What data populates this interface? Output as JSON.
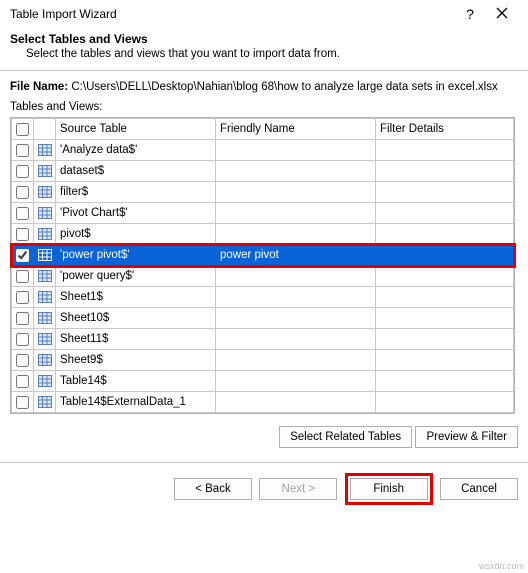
{
  "window": {
    "title": "Table Import Wizard",
    "help": "?",
    "heading": "Select Tables and Views",
    "subheading": "Select the tables and views that you want to import data from."
  },
  "file": {
    "label": "File Name:",
    "path": "C:\\Users\\DELL\\Desktop\\Nahian\\blog 68\\how to analyze large data sets in excel.xlsx"
  },
  "grid": {
    "caption": "Tables and Views:",
    "headers": {
      "source": "Source Table",
      "friendly": "Friendly Name",
      "filter": "Filter Details"
    },
    "rows": [
      {
        "checked": false,
        "source": "'Analyze data$'",
        "friendly": "",
        "filter": "",
        "selected": false
      },
      {
        "checked": false,
        "source": "dataset$",
        "friendly": "",
        "filter": "",
        "selected": false
      },
      {
        "checked": false,
        "source": "filter$",
        "friendly": "",
        "filter": "",
        "selected": false
      },
      {
        "checked": false,
        "source": "'Pivot Chart$'",
        "friendly": "",
        "filter": "",
        "selected": false
      },
      {
        "checked": false,
        "source": "pivot$",
        "friendly": "",
        "filter": "",
        "selected": false
      },
      {
        "checked": true,
        "source": "'power pivot$'",
        "friendly": "power pivot",
        "filter": "",
        "selected": true
      },
      {
        "checked": false,
        "source": "'power query$'",
        "friendly": "",
        "filter": "",
        "selected": false
      },
      {
        "checked": false,
        "source": "Sheet1$",
        "friendly": "",
        "filter": "",
        "selected": false
      },
      {
        "checked": false,
        "source": "Sheet10$",
        "friendly": "",
        "filter": "",
        "selected": false
      },
      {
        "checked": false,
        "source": "Sheet11$",
        "friendly": "",
        "filter": "",
        "selected": false
      },
      {
        "checked": false,
        "source": "Sheet9$",
        "friendly": "",
        "filter": "",
        "selected": false
      },
      {
        "checked": false,
        "source": "Table14$",
        "friendly": "",
        "filter": "",
        "selected": false
      },
      {
        "checked": false,
        "source": "Table14$ExternalData_1",
        "friendly": "",
        "filter": "",
        "selected": false
      }
    ]
  },
  "buttons": {
    "selectRelated": "Select Related Tables",
    "previewFilter": "Preview & Filter",
    "back": "< Back",
    "next": "Next >",
    "finish": "Finish",
    "cancel": "Cancel"
  },
  "watermark": "wsxdn.com"
}
